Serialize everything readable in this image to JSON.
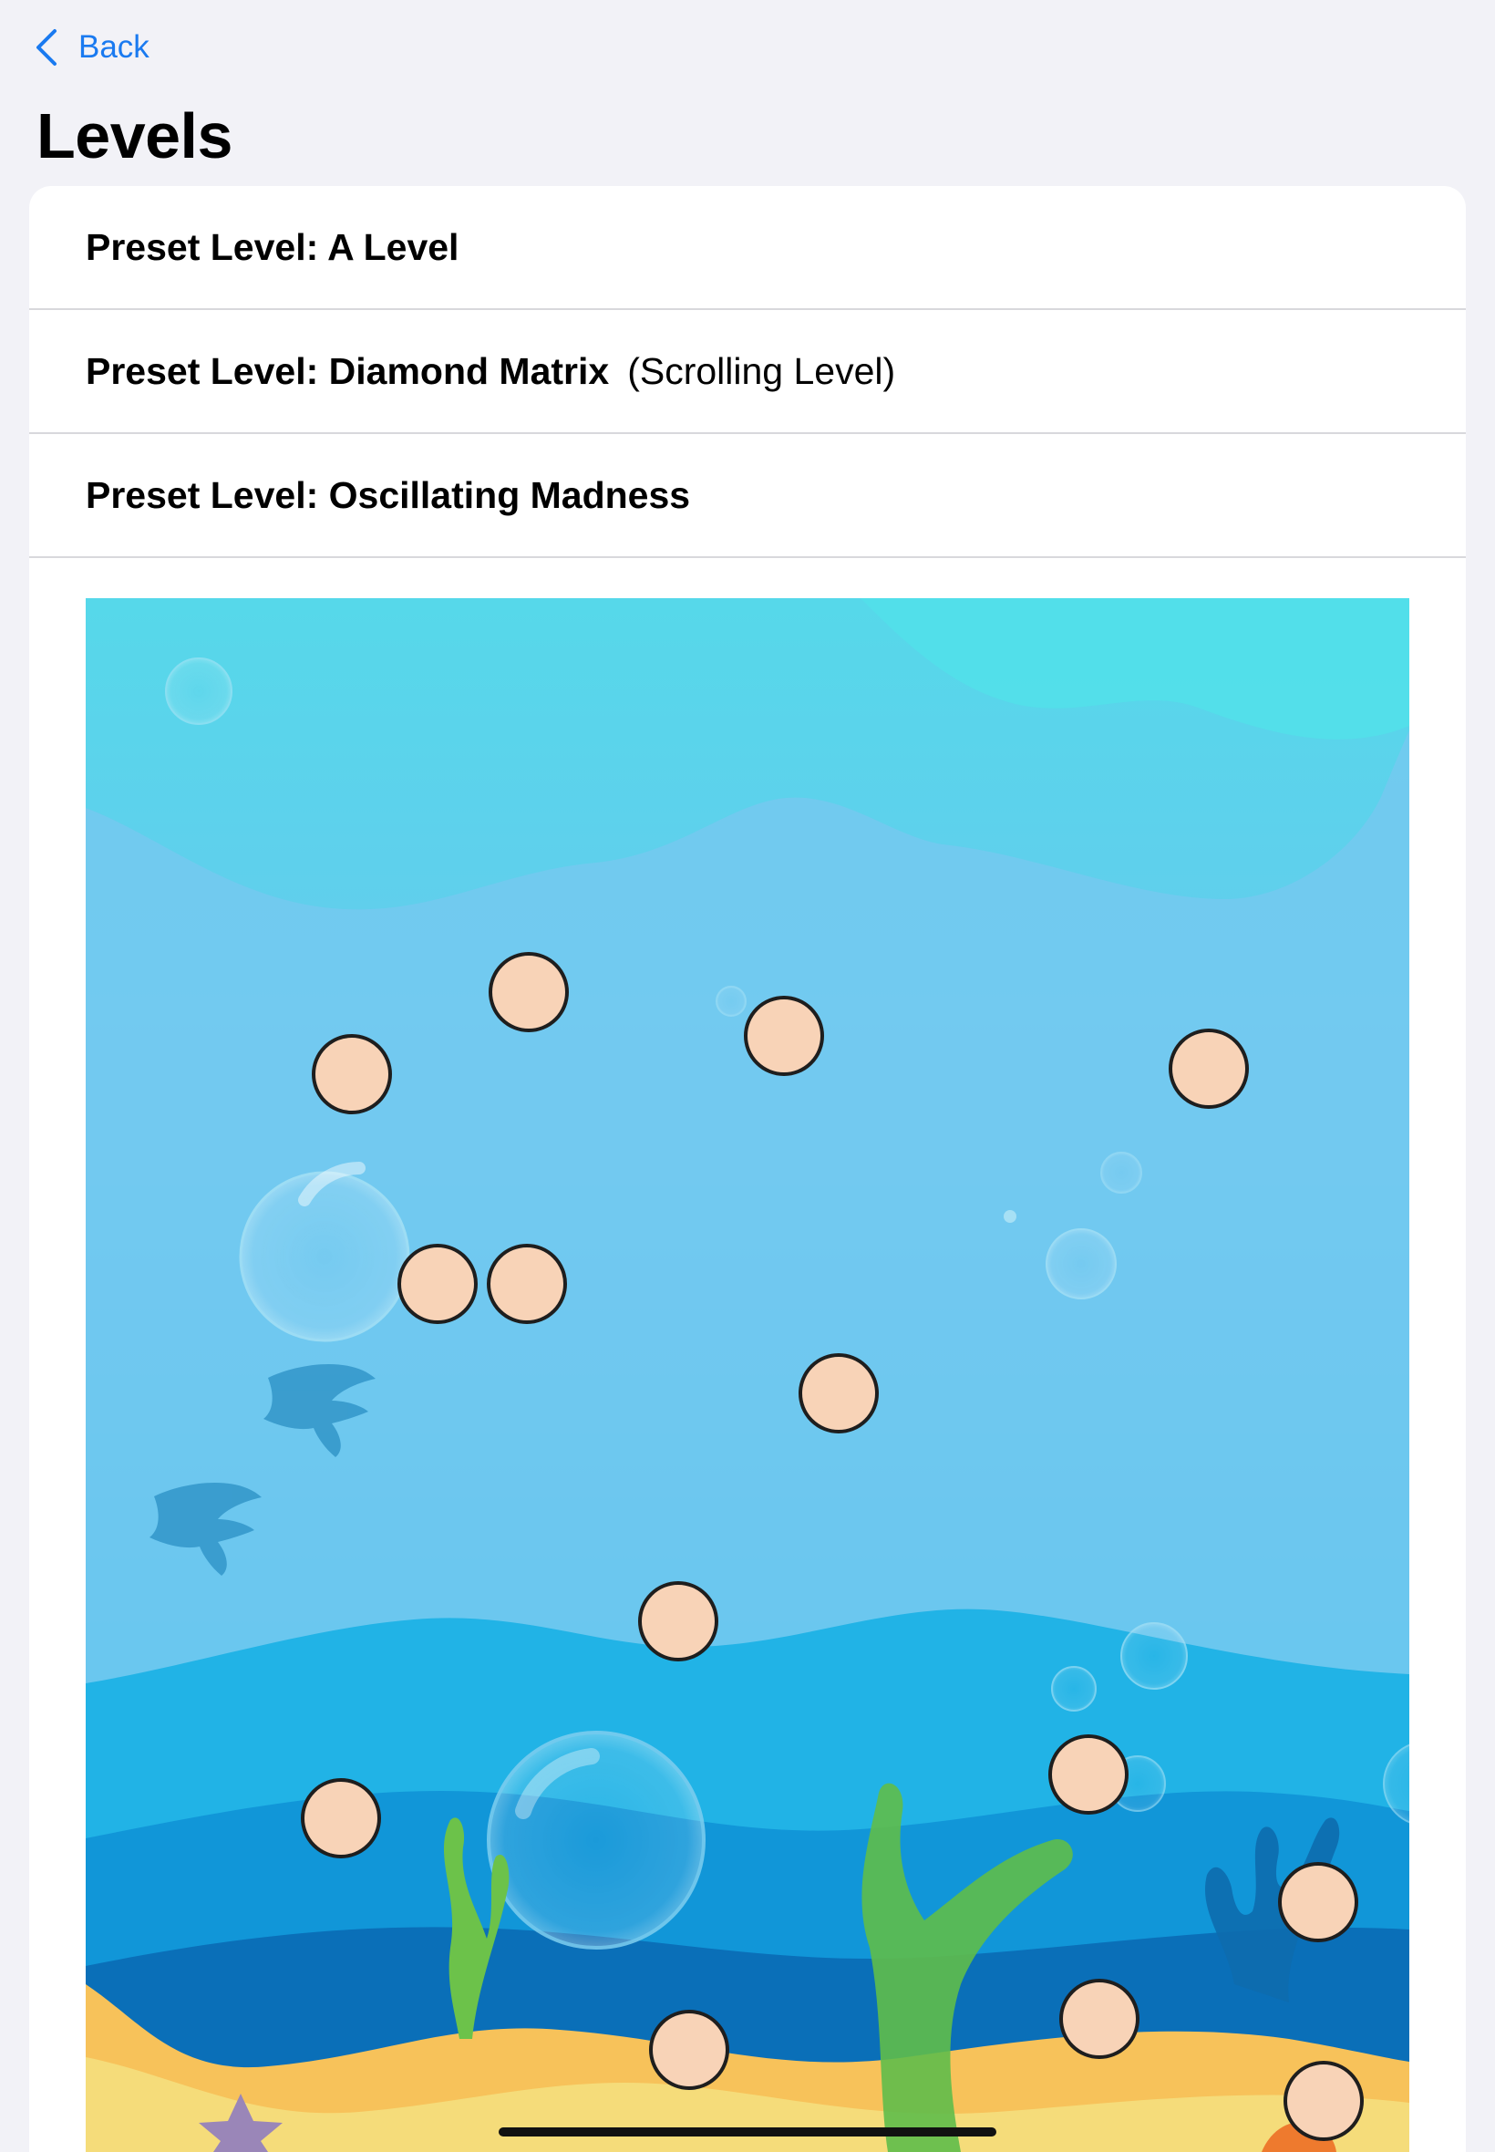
{
  "nav": {
    "back_label": "Back",
    "back_icon": "chevron-left-icon",
    "accent_color": "#1a7af0"
  },
  "page_title": "Levels",
  "levels": [
    {
      "title": "Preset Level: A Level",
      "subtitle": ""
    },
    {
      "title": "Preset Level: Diamond Matrix",
      "subtitle": "(Scrolling Level)"
    },
    {
      "title": "Preset Level: Oscillating Madness",
      "subtitle": ""
    }
  ],
  "preview": {
    "theme": "underwater",
    "peg_color": "#f8d3b7",
    "peg_count": 16
  }
}
